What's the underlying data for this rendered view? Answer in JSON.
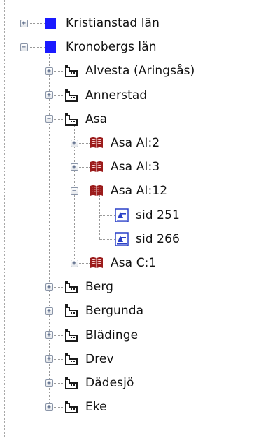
{
  "icon_types": {
    "county": "blue-square-icon",
    "parish": "parish-building-icon",
    "volume": "book-icon",
    "page": "page-image-icon"
  },
  "colors": {
    "county_square": "#1a1aff",
    "book": "#9b1b1b",
    "page_icon": "#2a40c8"
  },
  "tree": [
    {
      "label": "Kristianstad län",
      "type": "county",
      "expander": "plus",
      "level": 0
    },
    {
      "label": "Kronobergs län",
      "type": "county",
      "expander": "minus",
      "level": 0
    },
    {
      "label": "Alvesta (Aringsås)",
      "type": "parish",
      "expander": "plus",
      "level": 1
    },
    {
      "label": "Annerstad",
      "type": "parish",
      "expander": "plus",
      "level": 1
    },
    {
      "label": "Asa",
      "type": "parish",
      "expander": "minus",
      "level": 1
    },
    {
      "label": "Asa AI:2",
      "type": "volume",
      "expander": "plus",
      "level": 2
    },
    {
      "label": "Asa AI:3",
      "type": "volume",
      "expander": "plus",
      "level": 2
    },
    {
      "label": "Asa AI:12",
      "type": "volume",
      "expander": "minus",
      "level": 2
    },
    {
      "label": "sid 251",
      "type": "page",
      "expander": "none",
      "level": 3
    },
    {
      "label": "sid 266",
      "type": "page",
      "expander": "none",
      "level": 3
    },
    {
      "label": "Asa C:1",
      "type": "volume",
      "expander": "plus",
      "level": 2
    },
    {
      "label": "Berg",
      "type": "parish",
      "expander": "plus",
      "level": 1
    },
    {
      "label": "Bergunda",
      "type": "parish",
      "expander": "plus",
      "level": 1
    },
    {
      "label": "Blädinge",
      "type": "parish",
      "expander": "plus",
      "level": 1
    },
    {
      "label": "Drev",
      "type": "parish",
      "expander": "plus",
      "level": 1
    },
    {
      "label": "Dädesjö",
      "type": "parish",
      "expander": "plus",
      "level": 1
    },
    {
      "label": "Eke",
      "type": "parish",
      "expander": "plus",
      "level": 1
    }
  ]
}
